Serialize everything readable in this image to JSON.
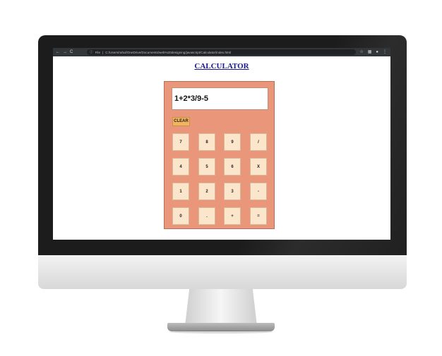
{
  "browser": {
    "nav": [
      "←",
      "→",
      "C"
    ],
    "url_scheme": "File",
    "url": "C:/Users/rahul/OneDrive/Documents/web%20designing/javascript/Calculator/index.html",
    "icons": [
      "star-icon",
      "extension-icon",
      "profile-icon",
      "menu-icon"
    ]
  },
  "page": {
    "title": "CALCULATOR"
  },
  "calculator": {
    "display_value": "1+2*3/9-5",
    "clear_label": "CLEAR",
    "keys": [
      [
        "7",
        "8",
        "9",
        "/"
      ],
      [
        "4",
        "5",
        "6",
        "X"
      ],
      [
        "1",
        "2",
        "3",
        "-"
      ],
      [
        "0",
        ".",
        "+",
        "="
      ]
    ]
  },
  "colors": {
    "calculator_bg": "#e9967a",
    "key_bg": "#fbe6cc",
    "clear_bg": "#f4b45e",
    "title": "#1a1a8c"
  }
}
